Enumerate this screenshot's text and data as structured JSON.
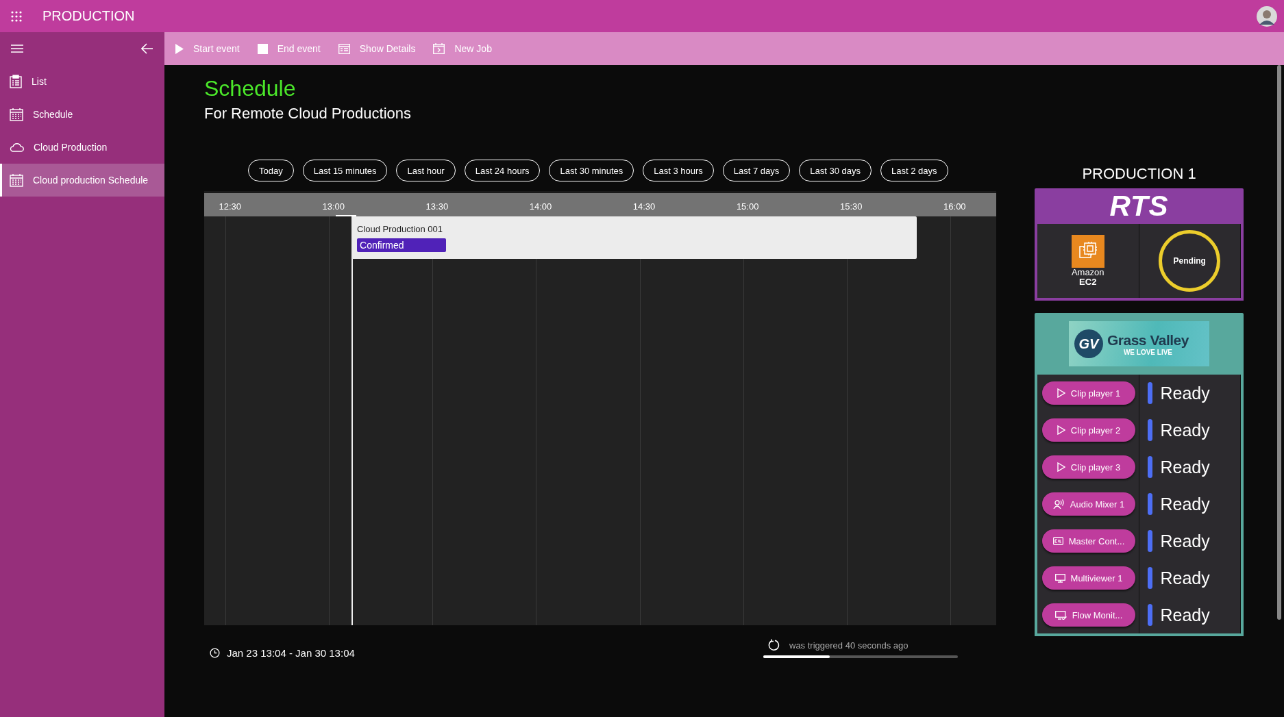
{
  "app_bar": {
    "title": "PRODUCTION"
  },
  "sidebar": {
    "items": [
      {
        "label": "List",
        "kind": "clipboard",
        "selected": false
      },
      {
        "label": "Schedule",
        "kind": "calendar",
        "selected": false
      },
      {
        "label": "Cloud Production",
        "kind": "cloud",
        "selected": false
      },
      {
        "label": "Cloud production Schedule",
        "kind": "calendar",
        "selected": true
      }
    ]
  },
  "toolbar": [
    {
      "label": "Start event",
      "kind": "play"
    },
    {
      "label": "End event",
      "kind": "stop"
    },
    {
      "label": "Show Details",
      "kind": "details"
    },
    {
      "label": "New Job",
      "kind": "newjob"
    }
  ],
  "page": {
    "title": "Schedule",
    "subtitle": "For Remote Cloud Productions"
  },
  "ranges": [
    "Today",
    "Last 15 minutes",
    "Last hour",
    "Last 24 hours",
    "Last 30 minutes",
    "Last 3 hours",
    "Last 7 days",
    "Last 30 days",
    "Last 2 days"
  ],
  "timeline": {
    "ticks": [
      "12:30",
      "13:00",
      "13:30",
      "14:00",
      "14:30",
      "15:00",
      "15:30",
      "16:00"
    ],
    "events": [
      {
        "name": "Cloud Production 001",
        "status": "Confirmed",
        "color": "#5022b8"
      }
    ]
  },
  "footer": {
    "range": "Jan 23 13:04 - Jan 30 13:04",
    "trigger": "was triggered 40 seconds ago",
    "level": 0.34
  },
  "production": {
    "title": "PRODUCTION 1",
    "rts": {
      "logo": "RTS",
      "cloud": "Amazon",
      "cloud_service": "EC2",
      "state": "Pending"
    },
    "vendor": {
      "mark": "GV",
      "name": "Grass Valley",
      "tagline": "WE LOVE LIVE"
    },
    "devices": [
      {
        "label": "Clip player 1",
        "kind": "play",
        "status": "Ready",
        "color": "#4d6ef5"
      },
      {
        "label": "Clip player 2",
        "kind": "play",
        "status": "Ready",
        "color": "#4d6ef5"
      },
      {
        "label": "Clip player 3",
        "kind": "play",
        "status": "Ready",
        "color": "#4d6ef5"
      },
      {
        "label": "Audio Mixer 1",
        "kind": "audio",
        "status": "Ready",
        "color": "#4d6ef5"
      },
      {
        "label": "Master Cont...",
        "kind": "ctrl",
        "status": "Ready",
        "color": "#4d6ef5"
      },
      {
        "label": "Multiviewer 1",
        "kind": "monitor",
        "status": "Ready",
        "color": "#4d6ef5"
      },
      {
        "label": "Flow Monit...",
        "kind": "monitorcheck",
        "status": "Ready",
        "color": "#4d6ef5"
      }
    ]
  }
}
